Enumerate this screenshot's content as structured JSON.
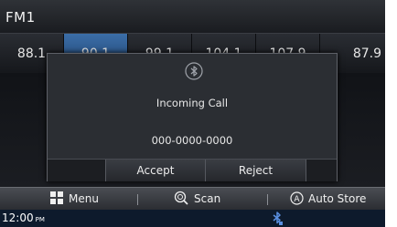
{
  "header": {
    "title": "FM1"
  },
  "presets": [
    {
      "label": "88.1"
    },
    {
      "label": "90.1"
    },
    {
      "label": "99.1"
    },
    {
      "label": "104.1"
    },
    {
      "label": "107.9"
    },
    {
      "label": "87.9"
    }
  ],
  "dialog": {
    "icon": "bluetooth-icon",
    "title": "Incoming Call",
    "number": "000-0000-0000",
    "accept_label": "Accept",
    "reject_label": "Reject"
  },
  "bottom_bar": {
    "menu_label": "Menu",
    "scan_label": "Scan",
    "autostore_label": "Auto Store"
  },
  "status": {
    "time": "12:00",
    "ampm": "PM"
  },
  "colors": {
    "active_preset": "#3b6ea8",
    "background": "#0a0b0d"
  }
}
